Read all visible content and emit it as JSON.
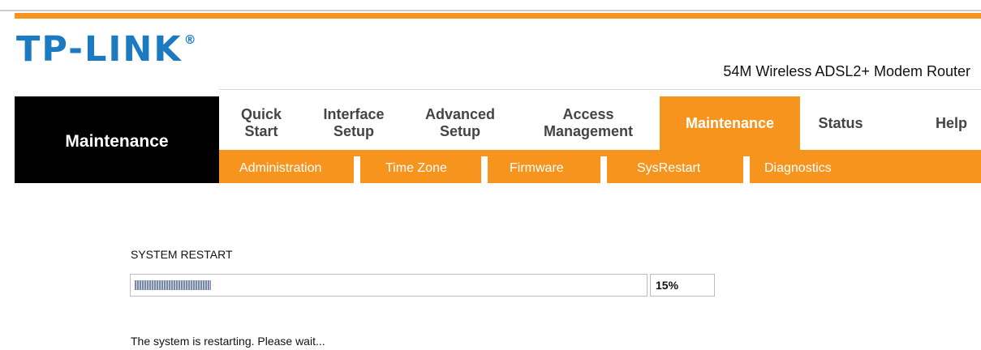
{
  "brand": {
    "logo": "TP-LINK",
    "registered": "®",
    "model": "54M Wireless ADSL2+ Modem Router"
  },
  "sidebar": {
    "title": "Maintenance"
  },
  "nav": {
    "tabs": [
      {
        "line1": "Quick",
        "line2": "Start"
      },
      {
        "line1": "Interface",
        "line2": "Setup"
      },
      {
        "line1": "Advanced",
        "line2": "Setup"
      },
      {
        "line1": "Access",
        "line2": "Management"
      },
      {
        "line1": "Maintenance",
        "line2": ""
      },
      {
        "line1": "Status",
        "line2": ""
      },
      {
        "line1": "Help",
        "line2": ""
      }
    ],
    "active": "Maintenance"
  },
  "subnav": {
    "items": [
      "Administration",
      "Time Zone",
      "Firmware",
      "SysRestart",
      "Diagnostics"
    ]
  },
  "restart": {
    "title": "SYSTEM RESTART",
    "progress_fraction": 0.15,
    "percent_text": "15%",
    "message": "The system is restarting. Please wait..."
  },
  "colors": {
    "accent": "#f7941d",
    "brand_blue": "#1c7ac0",
    "sidebar_bg": "#000000"
  }
}
